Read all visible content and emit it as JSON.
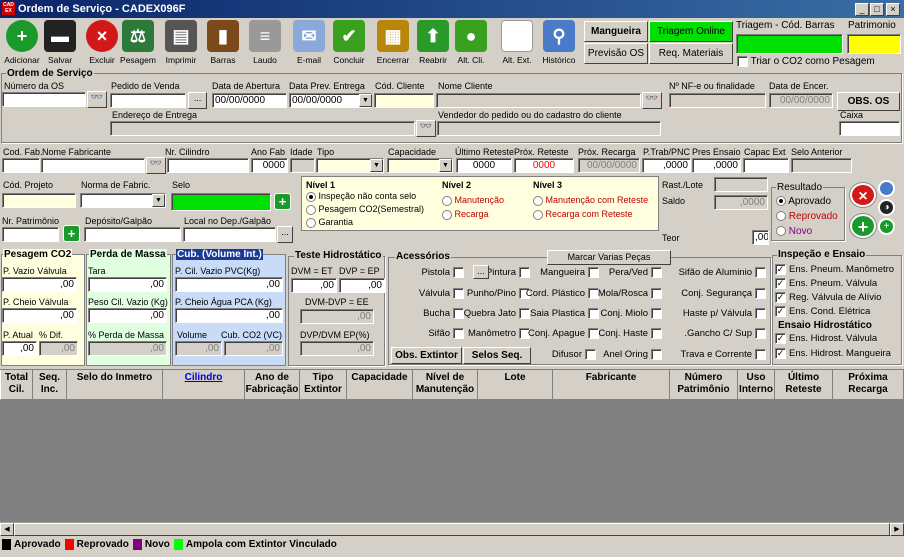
{
  "window": {
    "title": "Ordem de Serviço - CADEX096F",
    "app_icon": "CAD EX"
  },
  "toolbar": [
    {
      "label": "Adicionar",
      "icon": "add-icon",
      "color": "#1a9a2a"
    },
    {
      "label": "Salvar",
      "icon": "floppy-icon",
      "color": "#222"
    },
    {
      "label": "Excluir",
      "icon": "delete-icon",
      "color": "#d21818"
    },
    {
      "label": "Pesagem",
      "icon": "scale-icon",
      "color": "#2b7a3a"
    },
    {
      "label": "Imprimir",
      "icon": "printer-icon",
      "color": "#555"
    },
    {
      "label": "Barras",
      "icon": "barcode-icon",
      "color": "#7a4a1a"
    },
    {
      "label": "Laudo",
      "icon": "report-icon",
      "color": "#999"
    },
    {
      "label": "E-mail",
      "icon": "envelope-icon",
      "color": "#8aa8d8"
    },
    {
      "label": "Concluir",
      "icon": "check-icon",
      "color": "#3aa020"
    },
    {
      "label": "Encerrar",
      "icon": "clapper-icon",
      "color": "#b8860b"
    },
    {
      "label": "Reabrir",
      "icon": "arrow-up-icon",
      "color": "#2a9a2a"
    },
    {
      "label": "Alt. Cli.",
      "icon": "user-icon",
      "color": "#3aa020"
    },
    {
      "label": "Alt. Ext.",
      "icon": "blank-icon",
      "color": "#ffffff"
    },
    {
      "label": "Histórico",
      "icon": "magnifier-icon",
      "color": "#4a7ac8"
    }
  ],
  "top_buttons": {
    "mangueira": "Mangueira",
    "triagem_online": "Triagem Online",
    "previsao_os": "Previsão OS",
    "req_materiais": "Req. Materiais"
  },
  "triagem": {
    "label": "Triagem - Cód. Barras",
    "patrimonio_label": "Patrimonio",
    "co2_checkbox": "Triar o CO2 como Pesagem"
  },
  "os": {
    "section": "Ordem de Serviço",
    "numero_label": "Número da OS",
    "pedido_label": "Pedido de Venda",
    "abertura_label": "Data de Abertura",
    "abertura": "00/00/0000",
    "prev_label": "Data Prev. Entrega",
    "prev": "00/00/0000",
    "cod_cliente_label": "Cód. Cliente",
    "nome_cliente_label": "Nome Cliente",
    "nf_label": "Nº NF-e ou finalidade",
    "encer_label": "Data de Encer.",
    "encer": "00/00/0000",
    "obs_button": "OBS. OS",
    "endereco_label": "Endereço de Entrega",
    "vendedor_label": "Vendedor do pedido ou do cadastro do cliente",
    "caixa_label": "Caixa"
  },
  "fab": {
    "cod_fab_label": "Cod. Fab.",
    "nome_fab_label": "Nome Fabricante",
    "cilindro_label": "Nr. Cilindro",
    "ano_label": "Ano Fab",
    "ano": "0000",
    "idade_label": "Idade",
    "tipo_label": "Tipo",
    "capacidade_label": "Capacidade",
    "ult_reteste_label": "Último Reteste",
    "ult_reteste": "0000",
    "prox_reteste_label": "Próx. Reteste",
    "prox_reteste": "0000",
    "prox_recarga_label": "Próx. Recarga",
    "prox_recarga": "00/00/0000",
    "ptrab_label": "P.Trab/PNC",
    "ptrab": ",0000",
    "pres_label": "Pres Ensaio",
    "pres": ",0000",
    "capac_label": "Capac Ext",
    "selo_ant_label": "Selo Anterior"
  },
  "proj": {
    "cod_proj_label": "Cód. Projeto",
    "norma_label": "Norma de Fabric.",
    "selo_label": "Selo",
    "patrimonio_label": "Nr. Patrimônio",
    "deposito_label": "Depósito/Galpão",
    "local_label": "Local no Dep./Galpão"
  },
  "nivel": {
    "n1_title": "Nível 1",
    "n1_options": [
      "Inspeção não conta selo",
      "Pesagem CO2(Semestral)",
      "Garantia"
    ],
    "n2_title": "Nível 2",
    "n2_options": [
      "Manutenção",
      "Recarga"
    ],
    "n3_title": "Nível 3",
    "n3_options": [
      "Manutenção com Reteste",
      "Recarga com Reteste"
    ]
  },
  "right": {
    "rast_label": "Rast./Lote",
    "saldo_label": "Saldo",
    "saldo": ",0000",
    "teor_label": "Teor",
    "teor": ",00",
    "resultado_title": "Resultado",
    "resultado": [
      "Aprovado",
      "Reprovado",
      "Novo"
    ]
  },
  "pesagem": {
    "title": "Pesagem CO2",
    "vazio_label": "P. Vazio Válvula",
    "vazio": ",00",
    "cheio_label": "P. Cheio Válvula",
    "cheio": ",00",
    "atual_label": "P. Atual",
    "dif_label": "% Dif.",
    "atual": ",00",
    "dif": ",00"
  },
  "perda": {
    "title": "Perda de Massa",
    "tara_label": "Tara",
    "tara": ",00",
    "peso_label": "Peso Cil. Vazio (Kg)",
    "peso": ",00",
    "perc_label": "% Perda de Massa",
    "perc": ",00"
  },
  "cub": {
    "title": "Cub. (Volume Int.)",
    "vazio_label": "P. Cil. Vazio PVC(Kg)",
    "vazio": ",00",
    "cheio_label": "P. Cheio Água PCA (Kg)",
    "cheio": ",00",
    "volume_label": "Volume",
    "co2_label": "Cub. CO2 (VC)",
    "volume": ",00",
    "co2": ",00"
  },
  "hidro": {
    "title": "Teste Hidrostático",
    "dvm_et_label": "DVM = ET",
    "dvp_ep_label": "DVP = EP",
    "dvm": ",00",
    "dvp": ",00",
    "dvm_dvp_label": "DVM-DVP = EE",
    "dvm_dvp": ",00",
    "dvp_dvm_label": "DVP/DVM EP(%)",
    "dvp_dvm": ",00"
  },
  "acessorios": {
    "title": "Acessórios",
    "marcar": "Marcar Varias Peças",
    "obs_extintor": "Obs. Extintor",
    "selos_seq": "Selos Seq.",
    "rows": [
      [
        "Pistola",
        "Pintura",
        "Mangueira",
        "Pera/Ved",
        "Sifão de Aluminio"
      ],
      [
        "Válvula",
        "Punho/Pino",
        "Cord. Plástico",
        "Mola/Rosca",
        "Conj. Segurança"
      ],
      [
        "Bucha",
        "Quebra Jato",
        "Saia Plastica",
        "Conj. Miolo",
        "Haste p/ Válvula"
      ],
      [
        "Sifão",
        "Manômetro",
        "Conj. Apague",
        "Conj. Haste",
        ".Gancho C/ Sup"
      ],
      [
        "Difusor",
        "Anel Oring",
        "Trava e Corrente"
      ]
    ]
  },
  "inspecao": {
    "title": "Inspeção e Ensaio",
    "items": [
      "Ens. Pneum. Manômetro",
      "Ens. Pneum. Válvula",
      "Reg. Válvula de Alívio",
      "Ens. Cond. Elétrica"
    ],
    "hidro_title": "Ensaio Hidrostático",
    "hidro_items": [
      "Ens. Hidrost. Válvula",
      "Ens. Hidrost. Mangueira"
    ]
  },
  "grid": {
    "columns": [
      "Total Cil.",
      "Seq. Inc.",
      "Selo do Inmetro",
      "Cilindro",
      "Ano de Fabricação",
      "Tipo Extintor",
      "Capacidade",
      "Nível de Manutenção",
      "Lote",
      "Fabricante",
      "Número Patrimônio",
      "Uso Interno",
      "Último Reteste",
      "Próxima Recarga"
    ]
  },
  "legend": [
    {
      "label": "Aprovado",
      "color": "#000000"
    },
    {
      "label": "Reprovado",
      "color": "#ff0000"
    },
    {
      "label": "Novo",
      "color": "#800080"
    },
    {
      "label": "Ampola com Extintor Vinculado",
      "color": "#00ff00"
    }
  ],
  "colors": {
    "green": "#00e000",
    "yellow": "#ffff00",
    "title_start": "#0a246a"
  }
}
